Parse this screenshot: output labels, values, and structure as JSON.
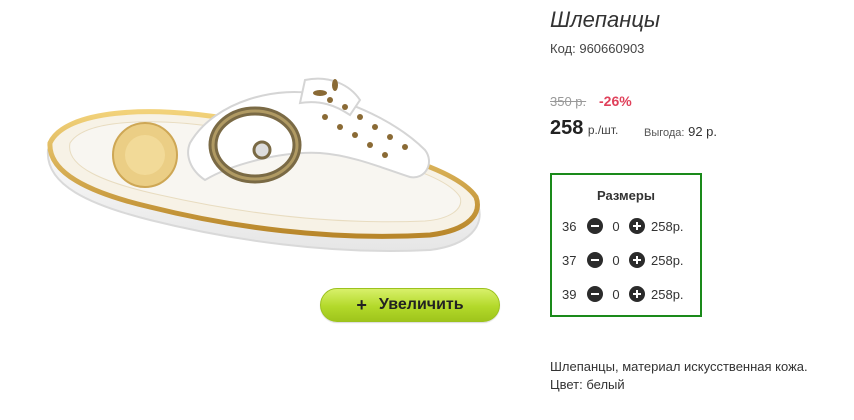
{
  "product": {
    "title": "Шлепанцы",
    "code_label": "Код:",
    "code": "960660903"
  },
  "pricing": {
    "old_price": "350 р.",
    "discount": "-26%",
    "price": "258",
    "price_unit": "р./шт.",
    "benefit_label": "Выгода:",
    "benefit_value": "92 р."
  },
  "zoom": {
    "label": "Увеличить",
    "icon": "plus-icon"
  },
  "sizes": {
    "title": "Размеры",
    "rows": [
      {
        "size": "36",
        "qty": "0",
        "price": "258р."
      },
      {
        "size": "37",
        "qty": "0",
        "price": "258р."
      },
      {
        "size": "39",
        "qty": "0",
        "price": "258р."
      }
    ]
  },
  "description": {
    "line1": "Шлепанцы, материал искусственная кожа.",
    "line2": "Цвет: белый"
  },
  "colors": {
    "accent_green": "#1a8a1a",
    "button_green": "#b3d92a",
    "discount_red": "#e0405a"
  }
}
